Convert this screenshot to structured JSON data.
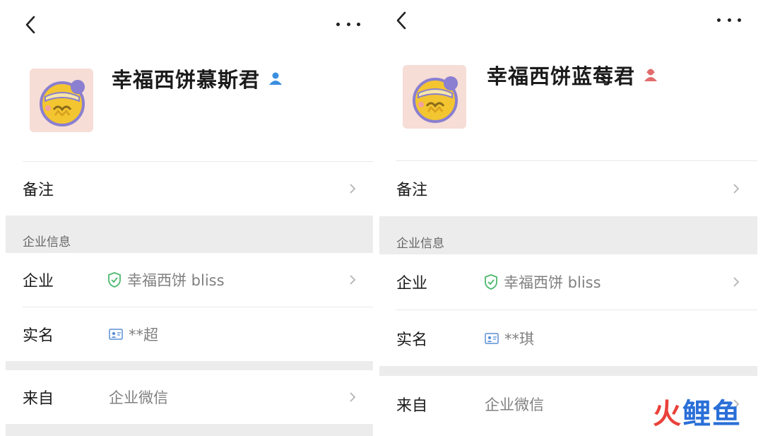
{
  "panels": [
    {
      "name": "幸福西饼慕斯君",
      "remark_label": "备注",
      "section_title": "企业信息",
      "company_label": "企业",
      "company_value": "幸福西饼 bliss",
      "realname_label": "实名",
      "realname_value": "**超",
      "from_label": "来自",
      "from_value": "企业微信",
      "gender_icon": "male-user-icon",
      "gender_color": "#3a8fe0"
    },
    {
      "name": "幸福西饼蓝莓君",
      "remark_label": "备注",
      "section_title": "企业信息",
      "company_label": "企业",
      "company_value": "幸福西饼 bliss",
      "realname_label": "实名",
      "realname_value": "**琪",
      "from_label": "来自",
      "from_value": "企业微信",
      "gender_icon": "female-user-icon",
      "gender_color": "#e26c6c"
    }
  ],
  "watermark": {
    "part1": "火",
    "part2": "鲤鱼"
  },
  "colors": {
    "verified_green": "#4cb86d",
    "id_card_blue": "#5b8fd6"
  }
}
